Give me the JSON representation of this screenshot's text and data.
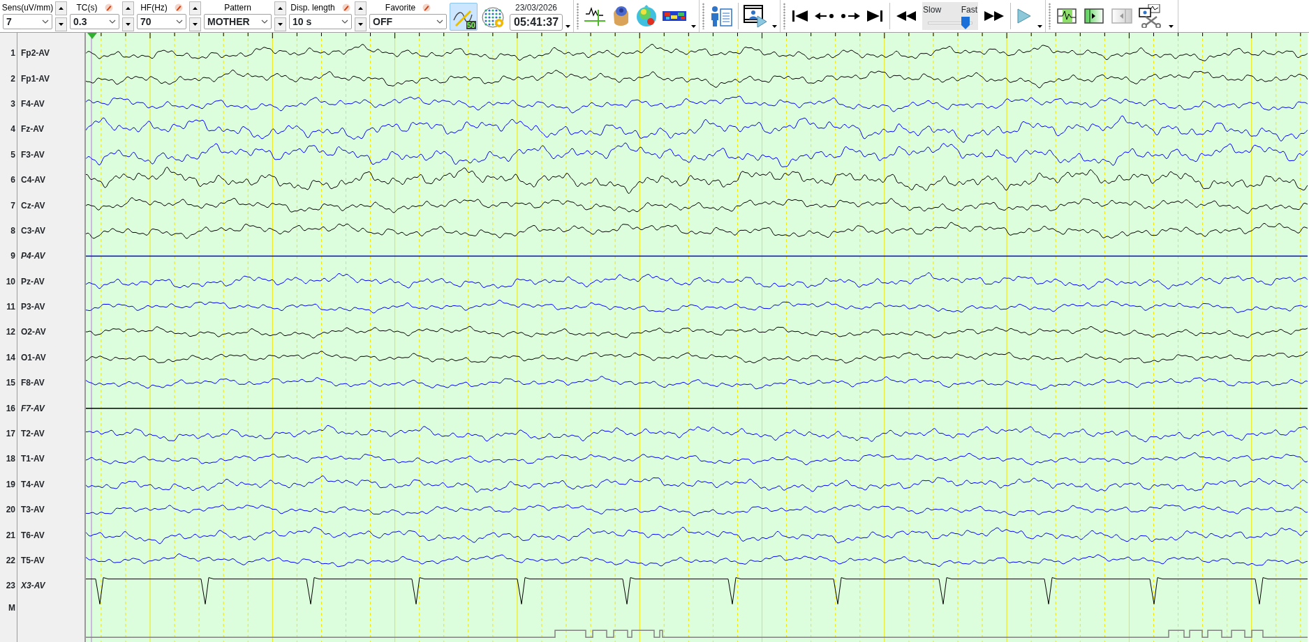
{
  "toolbar": {
    "fields": [
      {
        "label": "Sens(uV/mm)",
        "value": "7",
        "pencil": false,
        "spinner": true
      },
      {
        "label": "TC(s)",
        "value": "0.3",
        "pencil": true,
        "spinner": true
      },
      {
        "label": "HF(Hz)",
        "value": "70",
        "pencil": true,
        "spinner": true
      },
      {
        "label": "Pattern",
        "value": "MOTHER",
        "pencil": false,
        "spinner": true
      },
      {
        "label": "Disp. length",
        "value": "10 s",
        "pencil": true,
        "spinner": true
      },
      {
        "label": "Favorite",
        "value": "OFF",
        "pencil": true,
        "spinner": false
      }
    ],
    "notch_filter": {
      "label": "50",
      "selected": true
    },
    "date": "23/03/2026",
    "time": "05:41:37",
    "speed": {
      "slow_label": "Slow",
      "fast_label": "Fast",
      "level": 0.85
    },
    "clip_buttons": [
      {
        "kind": "wave",
        "disabled": false
      },
      {
        "kind": "play",
        "disabled": false
      },
      {
        "kind": "back",
        "disabled": true
      }
    ]
  },
  "channels": [
    {
      "number": "1",
      "name": "Fp2-AV",
      "color": "#000000",
      "excluded": false,
      "kind": "eeg"
    },
    {
      "number": "2",
      "name": "Fp1-AV",
      "color": "#000000",
      "excluded": false,
      "kind": "eeg"
    },
    {
      "number": "3",
      "name": "F4-AV",
      "color": "#0000ff",
      "excluded": false,
      "kind": "eeg"
    },
    {
      "number": "4",
      "name": "Fz-AV",
      "color": "#0000ff",
      "excluded": false,
      "kind": "eeg"
    },
    {
      "number": "5",
      "name": "F3-AV",
      "color": "#0000ff",
      "excluded": false,
      "kind": "eeg"
    },
    {
      "number": "6",
      "name": "C4-AV",
      "color": "#000000",
      "excluded": false,
      "kind": "eeg"
    },
    {
      "number": "7",
      "name": "Cz-AV",
      "color": "#000000",
      "excluded": false,
      "kind": "eeg"
    },
    {
      "number": "8",
      "name": "C3-AV",
      "color": "#000000",
      "excluded": false,
      "kind": "eeg"
    },
    {
      "number": "9",
      "name": "P4-AV",
      "color": "#0000ff",
      "excluded": true,
      "kind": "flat"
    },
    {
      "number": "10",
      "name": "Pz-AV",
      "color": "#0000ff",
      "excluded": false,
      "kind": "eeg"
    },
    {
      "number": "11",
      "name": "P3-AV",
      "color": "#0000ff",
      "excluded": false,
      "kind": "eeg"
    },
    {
      "number": "12",
      "name": "O2-AV",
      "color": "#000000",
      "excluded": false,
      "kind": "eeg"
    },
    {
      "number": "14",
      "name": "O1-AV",
      "color": "#000000",
      "excluded": false,
      "kind": "eeg"
    },
    {
      "number": "15",
      "name": "F8-AV",
      "color": "#0000ff",
      "excluded": false,
      "kind": "eeg"
    },
    {
      "number": "16",
      "name": "F7-AV",
      "color": "#000000",
      "excluded": true,
      "kind": "flat"
    },
    {
      "number": "17",
      "name": "T2-AV",
      "color": "#0000ff",
      "excluded": false,
      "kind": "eeg"
    },
    {
      "number": "18",
      "name": "T1-AV",
      "color": "#0000ff",
      "excluded": false,
      "kind": "eeg"
    },
    {
      "number": "19",
      "name": "T4-AV",
      "color": "#0000ff",
      "excluded": false,
      "kind": "eeg"
    },
    {
      "number": "20",
      "name": "T3-AV",
      "color": "#0000ff",
      "excluded": false,
      "kind": "eeg"
    },
    {
      "number": "21",
      "name": "T6-AV",
      "color": "#0000ff",
      "excluded": false,
      "kind": "eeg"
    },
    {
      "number": "22",
      "name": "T5-AV",
      "color": "#0000ff",
      "excluded": false,
      "kind": "eeg"
    },
    {
      "number": "23",
      "name": "X3-AV",
      "color": "#000000",
      "excluded": true,
      "kind": "ecg"
    }
  ],
  "marker_row": {
    "label": "M"
  }
}
